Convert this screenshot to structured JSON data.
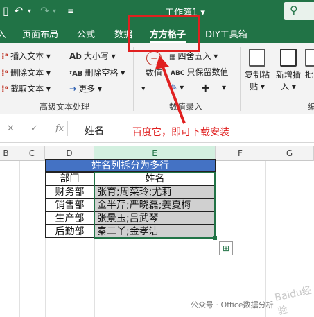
{
  "titlebar": {
    "title": "工作簿1 ▾",
    "undo_icon": "undo-icon",
    "redo_icon": "redo-icon",
    "customize_icon": "customize-icon",
    "search_icon": "search-icon"
  },
  "tabs": [
    {
      "label": "页面布局"
    },
    {
      "label": "公式"
    },
    {
      "label": "数据"
    },
    {
      "label": "方方格子"
    },
    {
      "label": "DIY工具箱"
    }
  ],
  "ribbon": {
    "text_group": {
      "insert_text": "插入文本",
      "delete_text": "删除文本",
      "cut_text": "截取文本",
      "case": "大小写",
      "delete_space": "删除空格",
      "more": "更多",
      "label": "高级文本处理"
    },
    "number_group": {
      "number": "数值",
      "round": "四舍五入",
      "keep_value": "只保留数值",
      "label": "数值录入"
    },
    "copy_paste": {
      "label1": "复制粘",
      "label2": "贴"
    },
    "insert_new": {
      "label1": "新增插",
      "label2": "入"
    },
    "batch": {
      "label1": "批"
    },
    "edit_label": "编"
  },
  "formula_bar": {
    "fx": "fx",
    "content": "姓名"
  },
  "annotation": "百度它，即可下载安装",
  "columns": [
    "B",
    "C",
    "D",
    "E",
    "F",
    "G"
  ],
  "sheet": {
    "title": "姓名列拆分为多行",
    "header_dept": "部门",
    "header_name": "姓名",
    "rows": [
      {
        "dept": "财务部",
        "names": "张育;周菜玲;尤莉"
      },
      {
        "dept": "销售部",
        "names": "金半芹;严晓磊;姜夏梅"
      },
      {
        "dept": "生产部",
        "names": "张景玉;吕武琴"
      },
      {
        "dept": "后勤部",
        "names": "秦二丫;金孝洁"
      }
    ]
  },
  "watermark": {
    "site": "Baidu经验",
    "account": "公众号 · Office数据分析"
  }
}
